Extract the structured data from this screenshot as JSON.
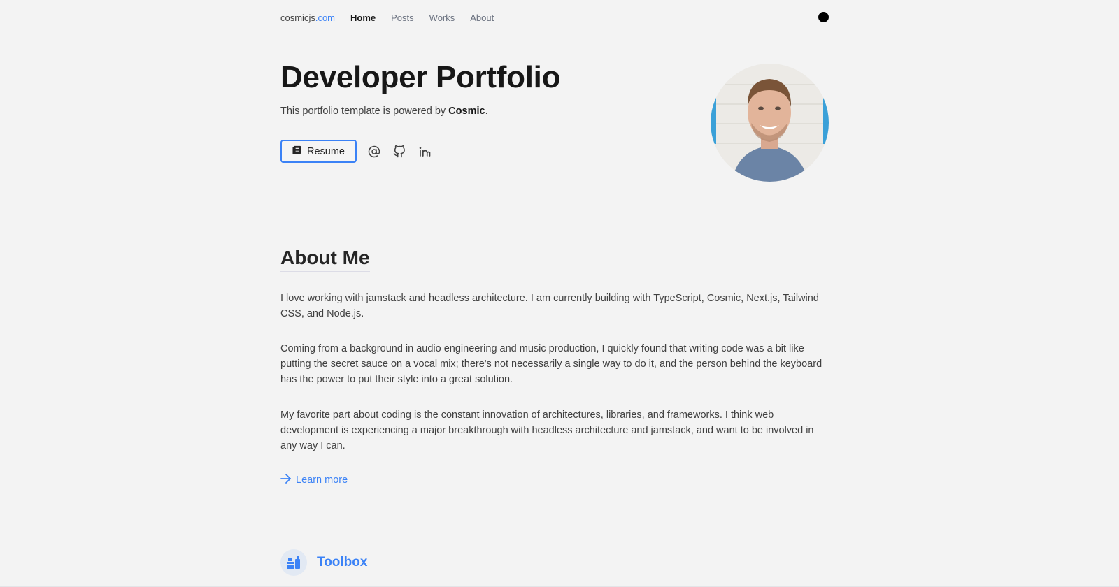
{
  "nav": {
    "brand_name": "cosmicjs",
    "brand_tld": ".com",
    "links": [
      {
        "label": "Home",
        "active": true
      },
      {
        "label": "Posts",
        "active": false
      },
      {
        "label": "Works",
        "active": false
      },
      {
        "label": "About",
        "active": false
      }
    ],
    "theme_toggle_icon": "dark-mode-circle-icon"
  },
  "hero": {
    "title": "Developer Portfolio",
    "subtitle_prefix": "This portfolio template is powered by ",
    "subtitle_bold": "Cosmic",
    "subtitle_suffix": ".",
    "resume_label": "Resume",
    "resume_icon": "document-icon",
    "social_icons": [
      "at-sign-icon",
      "github-icon",
      "linkedin-icon"
    ],
    "avatar_alt": "Profile photo of smiling man in blue t-shirt"
  },
  "about": {
    "title": "About Me",
    "paragraphs": [
      "I love working with jamstack and headless architecture. I am currently building with TypeScript, Cosmic, Next.js, Tailwind CSS, and Node.js.",
      "Coming from a background in audio engineering and music production, I quickly found that writing code was a bit like putting the secret sauce on a vocal mix; there's not necessarily a single way to do it, and the person behind the keyboard has the power to put their style into a great solution.",
      "My favorite part about coding is the constant innovation of architectures, libraries, and frameworks. I think web development is experiencing a major breakthrough with headless architecture and jamstack, and want to be involved in any way I can."
    ],
    "learn_more_label": "Learn more"
  },
  "toolbox": {
    "title": "Toolbox",
    "icon": "toolbox-icon"
  },
  "colors": {
    "accent": "#3b82f6",
    "background": "#f3f3f3",
    "text": "#404040"
  }
}
